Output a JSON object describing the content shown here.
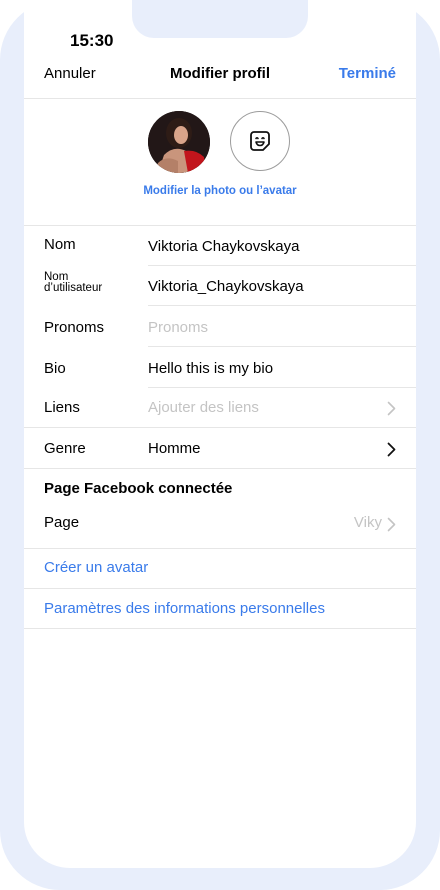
{
  "status_bar": {
    "time": "15:30"
  },
  "nav": {
    "cancel_label": "Annuler",
    "title": "Modifier profil",
    "done_label": "Terminé"
  },
  "avatar_section": {
    "edit_link": "Modifier la photo ou l’avatar"
  },
  "fields": {
    "name": {
      "label": "Nom",
      "value": "Viktoria Chaykovskaya"
    },
    "username": {
      "label_line1": "Nom",
      "label_line2": "d’utilisateur",
      "value": "Viktoria_Chaykovskaya"
    },
    "pronouns": {
      "label": "Pronoms",
      "placeholder": "Pronoms"
    },
    "bio": {
      "label": "Bio",
      "value": "Hello this is my bio"
    },
    "links": {
      "label": "Liens",
      "placeholder": "Ajouter des liens"
    },
    "gender": {
      "label": "Genre",
      "value": "Homme"
    }
  },
  "facebook_section": {
    "title": "Page Facebook connectée",
    "page_label": "Page",
    "page_value": "Viky"
  },
  "links_section": {
    "create_avatar": "Créer un avatar",
    "personal_info_settings": "Paramètres des informations personnelles"
  },
  "colors": {
    "accent": "#3a7bea",
    "frame": "#e8eefb",
    "placeholder": "#c4c4c4",
    "divider": "#e6e6e6"
  },
  "icons": {
    "avatar_face": "sticker-face-icon",
    "chevron": "chevron-right-icon"
  }
}
